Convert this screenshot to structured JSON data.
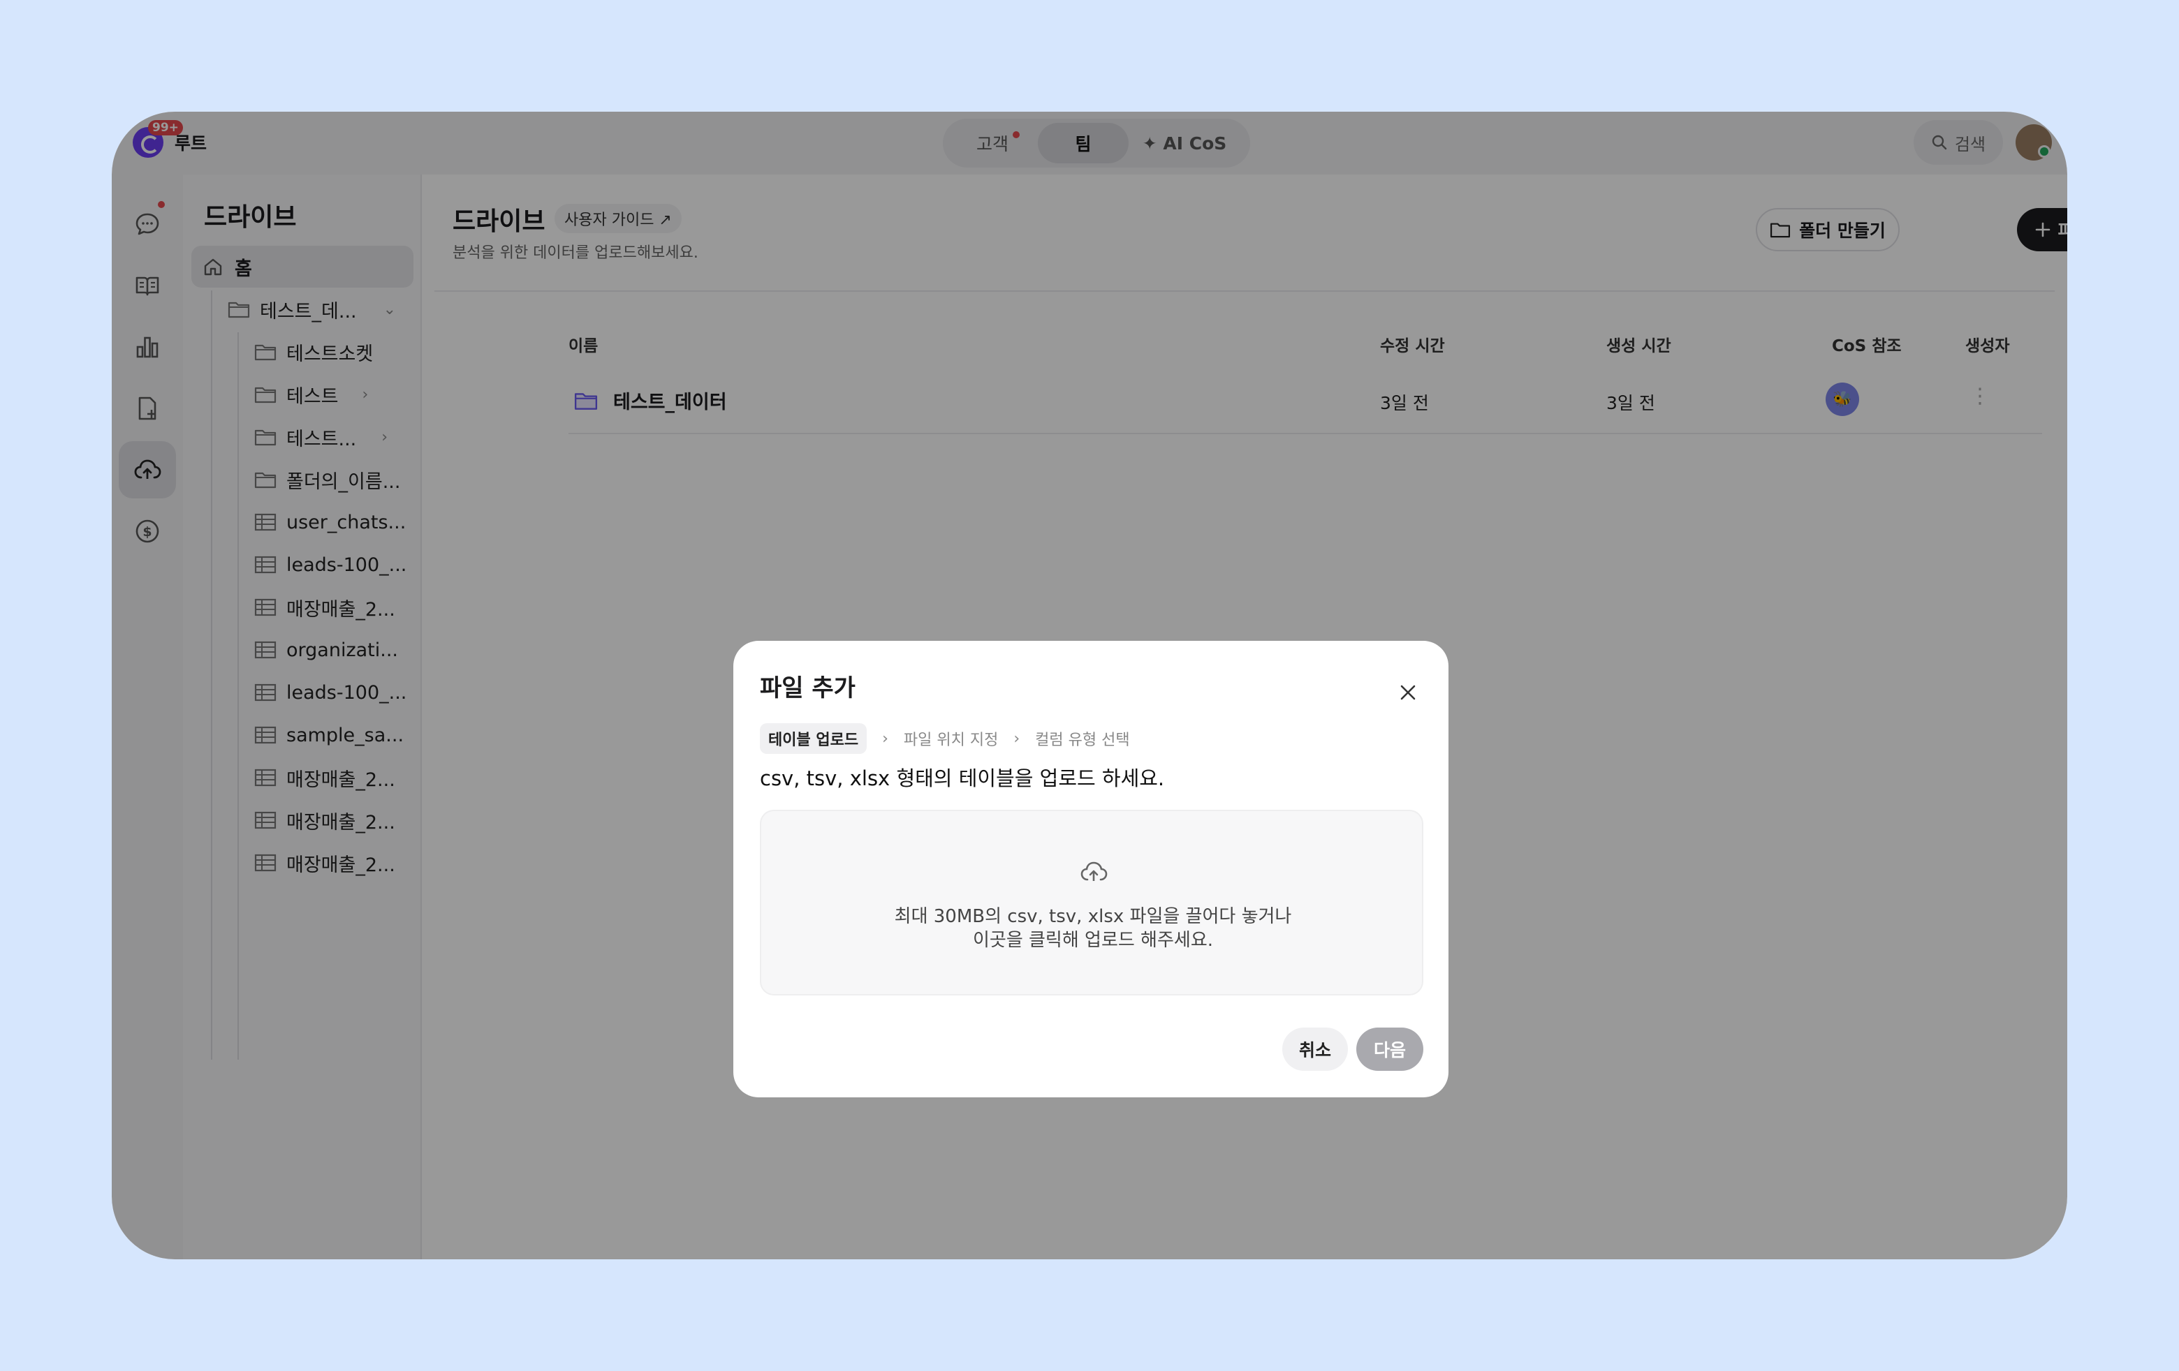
{
  "workspace": {
    "badge": "99+",
    "name": "루트"
  },
  "top_tabs": [
    {
      "label": "고객"
    },
    {
      "label": "팀"
    },
    {
      "label": "✦ AI CoS"
    }
  ],
  "search": {
    "label": "검색"
  },
  "sidebar": {
    "title": "드라이브",
    "home": "홈",
    "tree": [
      {
        "label": "테스트_데...",
        "type": "folder"
      },
      {
        "label": "테스트소켓",
        "type": "folder"
      },
      {
        "label": "테스트",
        "type": "folder"
      },
      {
        "label": "테스트...",
        "type": "folder"
      },
      {
        "label": "폴더의_이름...",
        "type": "folder"
      },
      {
        "label": "user_chats...",
        "type": "table"
      },
      {
        "label": "leads-100_...",
        "type": "table"
      },
      {
        "label": "매장매출_2...",
        "type": "table"
      },
      {
        "label": "organizati...",
        "type": "table"
      },
      {
        "label": "leads-100_...",
        "type": "table"
      },
      {
        "label": "sample_sa...",
        "type": "table"
      },
      {
        "label": "매장매출_2...",
        "type": "table"
      },
      {
        "label": "매장매출_2...",
        "type": "table"
      },
      {
        "label": "매장매출_2...",
        "type": "table"
      }
    ]
  },
  "main": {
    "title": "드라이브",
    "guide": "사용자 가이드 ↗",
    "subtitle": "분석을 위한 데이터를 업로드해보세요.",
    "new_folder": "폴더 만들기",
    "add_file": "파일 추가",
    "columns": {
      "name": "이름",
      "modified": "수정 시간",
      "created": "생성 시간",
      "cos": "CoS 참조",
      "creator": "생성자"
    },
    "rows": [
      {
        "name": "테스트_데이터",
        "modified": "3일 전",
        "created": "3일 전",
        "creator_emoji": "🐝"
      }
    ]
  },
  "modal": {
    "title": "파일 추가",
    "steps": [
      "테이블 업로드",
      "파일 위치 지정",
      "컬럼 유형 선택"
    ],
    "description": "csv, tsv, xlsx 형태의 테이블을 업로드 하세요.",
    "dropzone_line1": "최대 30MB의 csv, tsv, xlsx 파일을 끌어다 놓거나",
    "dropzone_line2": "이곳을 클릭해 업로드 해주세요.",
    "cancel": "취소",
    "next": "다음"
  },
  "colors": {
    "brand": "#6a3df0",
    "notification": "#e5484d",
    "online": "#22a55b",
    "primary_button": "#1c1c1e"
  }
}
